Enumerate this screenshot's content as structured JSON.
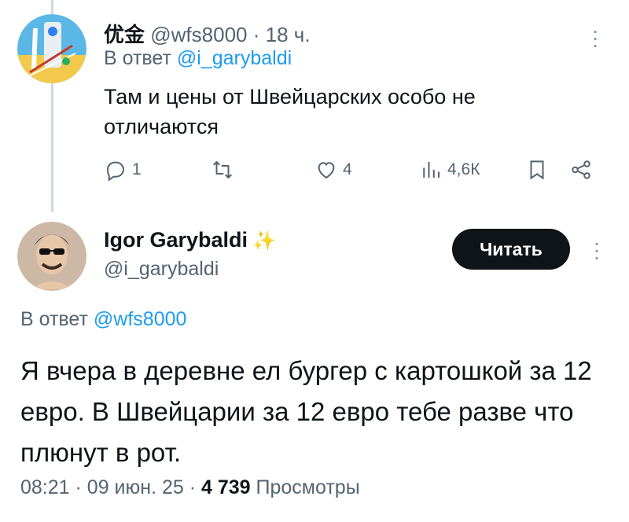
{
  "reply": {
    "name": "优金",
    "handle": "@wfs8000",
    "separator": "·",
    "time": "18 ч.",
    "reply_to_prefix": "В ответ",
    "reply_to_handle": "@i_garybaldi",
    "text": "Там и цены от Швейцарских особо не отличаются",
    "actions": {
      "replies": "1",
      "reposts": "",
      "likes": "4",
      "views": "4,6К"
    }
  },
  "main": {
    "name": "Igor Garybaldi",
    "badge": "✨",
    "handle": "@i_garybaldi",
    "follow_label": "Читать",
    "reply_to_prefix": "В ответ",
    "reply_to_handle": "@wfs8000",
    "text": "Я вчера в деревне ел бургер с картошкой за 12 евро. В Швейцарии за 12 евро тебе разве что плюнут в рот.",
    "footer": {
      "time": "08:21",
      "separator": "·",
      "date": "09 июн. 25",
      "views_count": "4 739",
      "views_label": "Просмотры"
    }
  },
  "colors": {
    "link": "#1d9bf0",
    "muted": "#536471",
    "text": "#0f1419",
    "button_bg": "#0f1419",
    "button_text": "#ffffff",
    "thread_line": "#cfd9de"
  },
  "icons": [
    "reply-icon",
    "repost-icon",
    "like-icon",
    "views-icon",
    "bookmark-icon",
    "share-icon",
    "more-icon"
  ]
}
